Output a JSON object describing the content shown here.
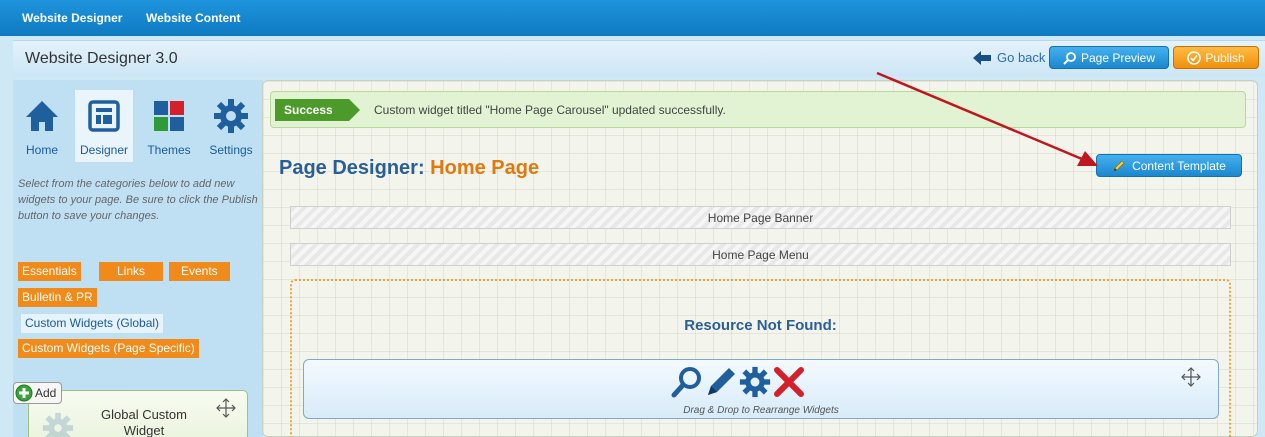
{
  "topnav": {
    "items": [
      "Website Designer",
      "Website Content"
    ]
  },
  "header": {
    "app_title": "Website Designer 3.0",
    "go_back": "Go back",
    "page_preview": "Page Preview",
    "publish": "Publish"
  },
  "sidebar": {
    "tools": [
      {
        "label": "Home",
        "icon": "home-icon"
      },
      {
        "label": "Designer",
        "icon": "designer-icon"
      },
      {
        "label": "Themes",
        "icon": "themes-icon"
      },
      {
        "label": "Settings",
        "icon": "gear-icon"
      }
    ],
    "help_text": "Select from the categories below to add new widgets to your page. Be sure to click the Publish button to save your changes.",
    "categories": [
      "Essentials",
      "Links",
      "Events",
      "Bulletin & PR",
      "Custom Widgets (Global)",
      "Custom Widgets (Page Specific)"
    ],
    "add_label": "Add",
    "widget_title": "Global Custom Widget"
  },
  "main": {
    "alert_tag": "Success",
    "alert_message": "Custom widget titled \"Home Page Carousel\" updated successfully.",
    "title_prefix": "Page Designer:",
    "page_name": "Home Page",
    "content_template": "Content Template",
    "banner": "Home Page Banner",
    "menu": "Home Page Menu",
    "resource_not_found": "Resource Not Found:",
    "drag_drop": "Drag & Drop to Rearrange Widgets"
  },
  "colors": {
    "topbar": "#1283cd",
    "accent_blue": "#1b88cf",
    "accent_orange": "#f08a1a",
    "success_green": "#4c9a2a",
    "annotation_arrow": "#c0161e"
  }
}
